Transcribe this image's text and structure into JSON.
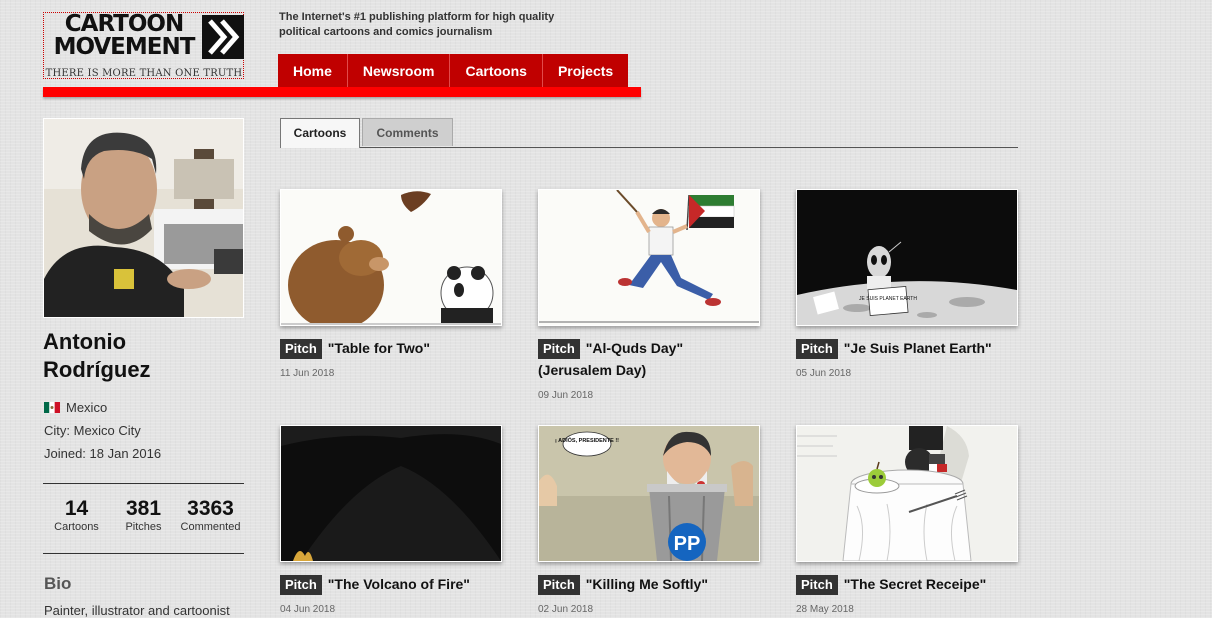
{
  "header": {
    "logo_line1": "CARTOON",
    "logo_line2": "MOVEMENT",
    "logo_tagline": "THERE IS MORE THAN ONE TRUTH",
    "tagline": "The Internet's #1 publishing platform for high quality political cartoons and comics journalism"
  },
  "nav": [
    "Home",
    "Newsroom",
    "Cartoons",
    "Projects"
  ],
  "profile": {
    "first_name": "Antonio",
    "last_name": "Rodríguez",
    "country": "Mexico",
    "city": "City: Mexico City",
    "joined": "Joined: 18 Jan 2016",
    "stats": [
      {
        "value": "14",
        "label": "Cartoons"
      },
      {
        "value": "381",
        "label": "Pitches"
      },
      {
        "value": "3363",
        "label": "Commented"
      }
    ],
    "bio_heading": "Bio",
    "bio_text": "Painter, illustrator and cartoonist"
  },
  "tabs": [
    "Cartoons",
    "Comments"
  ],
  "cards": [
    {
      "badge": "Pitch",
      "title": "\"Table for Two\"",
      "date": "11 Jun 2018"
    },
    {
      "badge": "Pitch",
      "title": "\"Al-Quds Day\" (Jerusalem Day)",
      "date": "09 Jun 2018"
    },
    {
      "badge": "Pitch",
      "title": "\"Je Suis Planet Earth\"",
      "date": "05 Jun 2018"
    },
    {
      "badge": "Pitch",
      "title": "\"The Volcano of Fire\"",
      "date": "04 Jun 2018"
    },
    {
      "badge": "Pitch",
      "title": "\"Killing Me Softly\"",
      "date": "02 Jun 2018"
    },
    {
      "badge": "Pitch",
      "title": "\"The Secret Receipe\"",
      "date": "28 May 2018"
    }
  ],
  "thumb_text": {
    "planet_sign": "JE SUIS PLANET EARTH",
    "bubble": "¡ ADIÓS, PRESIDENTE !!",
    "party_logo": "PP"
  },
  "colors": {
    "brand_red": "#c00000",
    "accent_red": "#ff0000",
    "badge": "#333333"
  }
}
